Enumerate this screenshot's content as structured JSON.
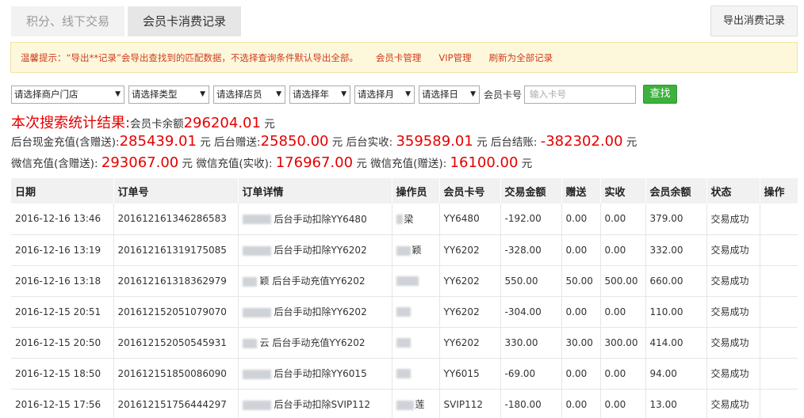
{
  "tabs": [
    {
      "label": "积分、线下交易"
    },
    {
      "label": "会员卡消费记录"
    }
  ],
  "export_button": "导出消费记录",
  "notice": {
    "text": "温馨提示：“导出**记录”会导出查找到的匹配数据，不选择查询条件默认导出全部。",
    "links": [
      "会员卡管理",
      "VIP管理",
      "刷新为全部记录"
    ]
  },
  "filters": {
    "store": "请选择商户门店",
    "type": "请选择类型",
    "clerk": "请选择店员",
    "year": "请选择年",
    "month": "请选择月",
    "day": "请选择日",
    "card_label": "会员卡号",
    "card_placeholder": "输入卡号",
    "search": "查找"
  },
  "stats": {
    "title": "本次搜索统计结果:",
    "card_balance_label": "会员卡余额",
    "card_balance": "296204.01",
    "unit": "元",
    "cash_recharge_label": "后台现金充值(含赠送):",
    "cash_recharge": "285439.01",
    "backend_gift_label": "后台赠送:",
    "backend_gift": "25850.00",
    "backend_received_label": "后台实收:",
    "backend_received": "359589.01",
    "backend_settle_label": "后台结账:",
    "backend_settle": "-382302.00",
    "wx_recharge_label": "微信充值(含赠送):",
    "wx_recharge": "293067.00",
    "wx_received_label": "微信充值(实收):",
    "wx_received": "176967.00",
    "wx_gift_label": "微信充值(赠送):",
    "wx_gift": "16100.00"
  },
  "table": {
    "headers": [
      "日期",
      "订单号",
      "订单详情",
      "操作员",
      "会员卡号",
      "交易金额",
      "赠送",
      "实收",
      "会员余额",
      "状态",
      "操作"
    ],
    "rows": [
      {
        "date": "2016-12-16 13:46",
        "order": "201612161346286583",
        "detail": "后台手动扣除YY6480",
        "operator": "梁",
        "card": "YY6480",
        "amount": "-192.00",
        "gift": "0.00",
        "received": "0.00",
        "balance": "379.00",
        "status": "交易成功"
      },
      {
        "date": "2016-12-16 13:19",
        "order": "201612161319175085",
        "detail": "后台手动扣除YY6202",
        "operator": "颖",
        "card": "YY6202",
        "amount": "-328.00",
        "gift": "0.00",
        "received": "0.00",
        "balance": "332.00",
        "status": "交易成功"
      },
      {
        "date": "2016-12-16 13:18",
        "order": "201612161318362979",
        "detail": "颖 后台手动充值YY6202",
        "operator": "",
        "card": "YY6202",
        "amount": "550.00",
        "gift": "50.00",
        "received": "500.00",
        "balance": "660.00",
        "status": "交易成功"
      },
      {
        "date": "2016-12-15 20:51",
        "order": "201612152051079070",
        "detail": "后台手动扣除YY6202",
        "operator": "",
        "card": "YY6202",
        "amount": "-304.00",
        "gift": "0.00",
        "received": "0.00",
        "balance": "110.00",
        "status": "交易成功"
      },
      {
        "date": "2016-12-15 20:50",
        "order": "201612152050545931",
        "detail": "云 后台手动充值YY6202",
        "operator": "",
        "card": "YY6202",
        "amount": "330.00",
        "gift": "30.00",
        "received": "300.00",
        "balance": "414.00",
        "status": "交易成功"
      },
      {
        "date": "2016-12-15 18:50",
        "order": "201612151850086090",
        "detail": "后台手动扣除YY6015",
        "operator": "",
        "card": "YY6015",
        "amount": "-69.00",
        "gift": "0.00",
        "received": "0.00",
        "balance": "94.00",
        "status": "交易成功"
      },
      {
        "date": "2016-12-15 17:56",
        "order": "201612151756444297",
        "detail": "后台手动扣除SVIP112",
        "operator": "莲",
        "card": "SVIP112",
        "amount": "-180.00",
        "gift": "0.00",
        "received": "0.00",
        "balance": "13.00",
        "status": "交易成功"
      }
    ]
  }
}
